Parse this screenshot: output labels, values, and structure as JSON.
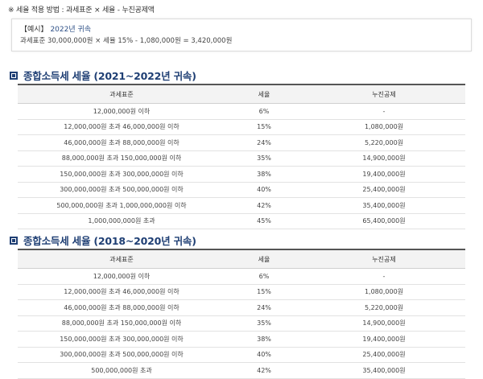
{
  "note": "※ 세율 적용 방법 : 과세표준 × 세율 - 누진공제액",
  "example": {
    "tag": "【예시】",
    "year": "2022년 귀속",
    "formula": "과세표준 30,000,000원 × 세율 15% - 1,080,000원 = 3,420,000원"
  },
  "tables": [
    {
      "title": "종합소득세 세율 (2021~2022년 귀속)",
      "headers": [
        "과세표준",
        "세율",
        "누진공제"
      ],
      "rows": [
        [
          "12,000,000원 이하",
          "6%",
          "-"
        ],
        [
          "12,000,000원 초과 46,000,000원 이하",
          "15%",
          "1,080,000원"
        ],
        [
          "46,000,000원 초과 88,000,000원 이하",
          "24%",
          "5,220,000원"
        ],
        [
          "88,000,000원 초과 150,000,000원 이하",
          "35%",
          "14,900,000원"
        ],
        [
          "150,000,000원 초과 300,000,000원 이하",
          "38%",
          "19,400,000원"
        ],
        [
          "300,000,000원 초과 500,000,000원 이하",
          "40%",
          "25,400,000원"
        ],
        [
          "500,000,000원 초과 1,000,000,000원 이하",
          "42%",
          "35,400,000원"
        ],
        [
          "1,000,000,000원 초과",
          "45%",
          "65,400,000원"
        ]
      ]
    },
    {
      "title": "종합소득세 세율 (2018~2020년 귀속)",
      "headers": [
        "과세표준",
        "세율",
        "누진공제"
      ],
      "rows": [
        [
          "12,000,000원 이하",
          "6%",
          "-"
        ],
        [
          "12,000,000원 초과 46,000,000원 이하",
          "15%",
          "1,080,000원"
        ],
        [
          "46,000,000원 초과 88,000,000원 이하",
          "24%",
          "5,220,000원"
        ],
        [
          "88,000,000원 초과 150,000,000원 이하",
          "35%",
          "14,900,000원"
        ],
        [
          "150,000,000원 초과 300,000,000원 이하",
          "38%",
          "19,400,000원"
        ],
        [
          "300,000,000원 초과 500,000,000원 이하",
          "40%",
          "25,400,000원"
        ],
        [
          "500,000,000원 초과",
          "42%",
          "35,400,000원"
        ]
      ]
    }
  ]
}
